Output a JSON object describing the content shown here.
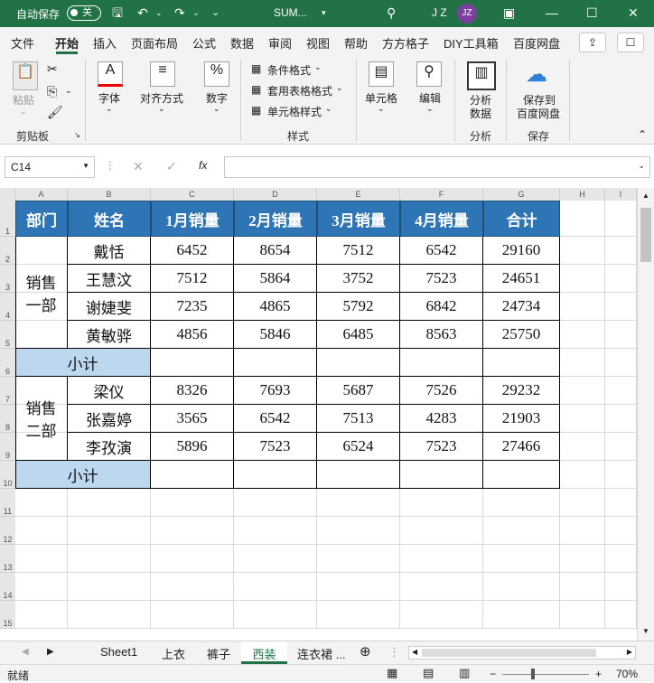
{
  "titlebar": {
    "autosave": "自动保存",
    "toggle": "关",
    "filename": "SUM...",
    "user": "J Z",
    "avatar": "JZ"
  },
  "tabs": [
    "文件",
    "开始",
    "插入",
    "页面布局",
    "公式",
    "数据",
    "审阅",
    "视图",
    "帮助",
    "方方格子",
    "DIY工具箱",
    "百度网盘"
  ],
  "ribbon": {
    "paste": "粘贴",
    "font": "字体",
    "align": "对齐方式",
    "number": "数字",
    "cond": "条件格式",
    "table_fmt": "套用表格格式",
    "cell_style": "单元格样式",
    "cells": "单元格",
    "edit": "编辑",
    "analyze": "分析\n数据",
    "save_baidu": "保存到\n百度网盘",
    "g_clipboard": "剪贴板",
    "g_style": "样式",
    "g_analyze": "分析",
    "g_save": "保存",
    "analyze1": "分析",
    "analyze2": "数据",
    "save1": "保存到",
    "save2": "百度网盘"
  },
  "formula": {
    "namebox": "C14",
    "fx": "fx",
    "value": ""
  },
  "columns": [
    "A",
    "B",
    "C",
    "D",
    "E",
    "F",
    "G",
    "H",
    "I"
  ],
  "rows": [
    "1",
    "2",
    "3",
    "4",
    "5",
    "6",
    "7",
    "8",
    "9",
    "10",
    "11",
    "12",
    "13",
    "14",
    "15"
  ],
  "table": {
    "headers": [
      "部门",
      "姓名",
      "1月销量",
      "2月销量",
      "3月销量",
      "4月销量",
      "合计"
    ],
    "dept1": "销售\n一部",
    "dept1a": "销售",
    "dept1b": "一部",
    "dept2a": "销售",
    "dept2b": "二部",
    "group1": [
      [
        "戴恬",
        "6452",
        "8654",
        "7512",
        "6542",
        "29160"
      ],
      [
        "王慧汶",
        "7512",
        "5864",
        "3752",
        "7523",
        "24651"
      ],
      [
        "谢婕斐",
        "7235",
        "4865",
        "5792",
        "6842",
        "24734"
      ],
      [
        "黄敏骅",
        "4856",
        "5846",
        "6485",
        "8563",
        "25750"
      ]
    ],
    "group2": [
      [
        "梁仪",
        "8326",
        "7693",
        "5687",
        "7526",
        "29232"
      ],
      [
        "张嘉婷",
        "3565",
        "6542",
        "7513",
        "4283",
        "21903"
      ],
      [
        "李孜演",
        "5896",
        "7523",
        "6524",
        "7523",
        "27466"
      ]
    ],
    "subtotal": "小计"
  },
  "sheets": [
    "Sheet1",
    "上衣",
    "裤子",
    "西装",
    "连衣裙 ..."
  ],
  "status": {
    "ready": "就绪",
    "zoom": "70%"
  },
  "colors": {
    "titlebar": "#217346",
    "header": "#2e75b6",
    "subtotal": "#bdd7ee"
  }
}
